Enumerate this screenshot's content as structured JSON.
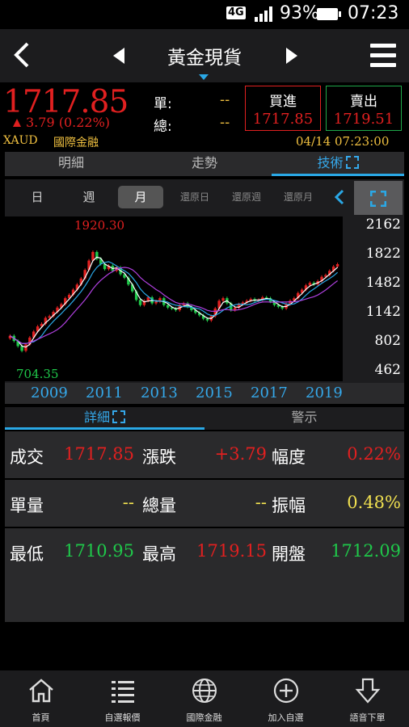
{
  "status_bar": {
    "network": "4G",
    "battery": "93%",
    "time": "07:23"
  },
  "header": {
    "title": "黃金現貨"
  },
  "quote": {
    "last_price": "1717.85",
    "change": "3.79 (0.22%)",
    "single_label": "單:",
    "single_value": "--",
    "total_label": "總:",
    "total_value": "--",
    "buy_label": "買進",
    "buy_value": "1717.85",
    "sell_label": "賣出",
    "sell_value": "1719.51",
    "code": "XAUD",
    "market": "國際金融",
    "datetime": "04/14 07:23:00"
  },
  "main_tabs": [
    "明細",
    "走勢",
    "技術"
  ],
  "period_tabs": [
    "日",
    "週",
    "月",
    "還原日",
    "還原週",
    "還原月"
  ],
  "chart_data": {
    "type": "candlestick",
    "high_label": "1920.30",
    "low_label": "704.35",
    "y_ticks": [
      "2162",
      "1822",
      "1482",
      "1142",
      "802",
      "462"
    ],
    "ylim": [
      462,
      2162
    ],
    "x_ticks": [
      "2009",
      "2011",
      "2013",
      "2015",
      "2017",
      "2019"
    ],
    "series": [
      {
        "values": [
          880,
          820,
          760,
          705,
          780,
          860,
          930,
          990,
          1020,
          1090,
          1110,
          1160,
          1210,
          1250,
          1320,
          1360,
          1420,
          1480,
          1550,
          1650,
          1760,
          1860,
          1780,
          1720,
          1660,
          1700,
          1640,
          1680,
          1600,
          1560,
          1480,
          1400,
          1300,
          1240,
          1290,
          1330,
          1260,
          1280,
          1320,
          1240,
          1210,
          1200,
          1180,
          1240,
          1260,
          1220,
          1180,
          1150,
          1120,
          1080,
          1060,
          1110,
          1200,
          1290,
          1320,
          1260,
          1180,
          1210,
          1250,
          1270,
          1290,
          1310,
          1290,
          1300,
          1330,
          1320,
          1280,
          1240,
          1220,
          1200,
          1250,
          1290,
          1320,
          1380,
          1420,
          1470,
          1500,
          1480,
          1520,
          1570,
          1590,
          1640,
          1690,
          1718
        ]
      }
    ],
    "colors": {
      "up": "#e02020",
      "down": "#1fc84a",
      "ma1": "#ffffff",
      "ma2": "#2aa8e6",
      "ma3": "#b040e0"
    }
  },
  "sub_tabs": [
    "詳細",
    "警示"
  ],
  "stats": {
    "rows": [
      [
        {
          "k": "成交",
          "v": "1717.85",
          "c": "red"
        },
        {
          "k": "漲跌",
          "v": "+3.79",
          "c": "red"
        },
        {
          "k": "幅度",
          "v": "0.22%",
          "c": "red"
        }
      ],
      [
        {
          "k": "單量",
          "v": "--",
          "c": "yellow"
        },
        {
          "k": "總量",
          "v": "--",
          "c": "yellow"
        },
        {
          "k": "振幅",
          "v": "0.48%",
          "c": "yellow"
        }
      ],
      [
        {
          "k": "最低",
          "v": "1710.95",
          "c": "green"
        },
        {
          "k": "最高",
          "v": "1719.15",
          "c": "red"
        },
        {
          "k": "開盤",
          "v": "1712.09",
          "c": "green"
        }
      ]
    ]
  },
  "bottom_nav": [
    "首頁",
    "自選報價",
    "國際金融",
    "加入自選",
    "語音下單"
  ]
}
